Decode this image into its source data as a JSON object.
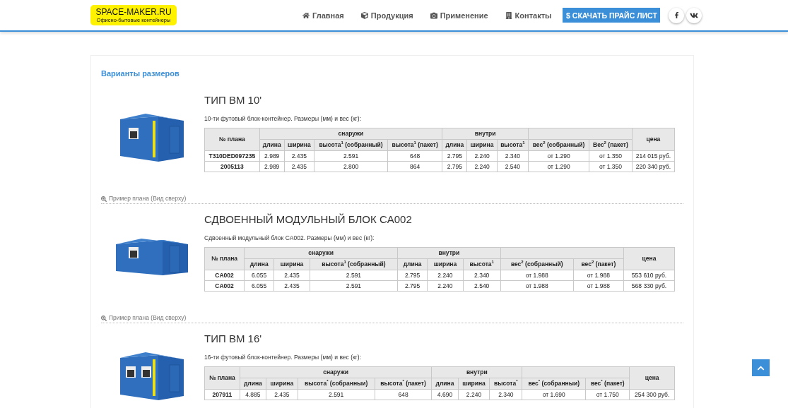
{
  "header": {
    "logo": {
      "title": "SPACE-MAKER.RU",
      "subtitle": "Офисно-бытовые контейнеры"
    },
    "nav": [
      {
        "label": "Главная",
        "kind": "home"
      },
      {
        "label": "Продукция",
        "kind": "cube"
      },
      {
        "label": "Применение",
        "kind": "camera"
      },
      {
        "label": "Контакты",
        "kind": "building"
      }
    ],
    "price_button": "$ СКАЧАТЬ ПРАЙС ЛИСТ",
    "social": [
      {
        "kind": "facebook"
      },
      {
        "kind": "vk"
      }
    ]
  },
  "heading": "Варианты размеров",
  "sections": [
    {
      "title": "ТИП ВМ 10'",
      "description": "10-ти футовый блок-контейнер. Размеры (мм) и вес (кг):",
      "image": {
        "kind": "picture"
      },
      "plan_header": "№ плана",
      "outside_header": "снаружи",
      "inside_header": "внутри",
      "price_header": "цена",
      "outside_columns": [
        "длина",
        "ширина",
        "высота$^{1}$ (собранный)",
        "высота$^{1}$ (пакет)"
      ],
      "inside_columns": [
        "длина",
        "ширина",
        "высота$^{1}$"
      ],
      "weight_columns": [
        "вес$^{2}$ (собранный)",
        "Вес$^{2}$ (пакет)"
      ],
      "rows": [
        [
          "T310DED097235",
          "2.989",
          "2.435",
          "2.591",
          "648",
          "2.795",
          "2.240",
          "2.340",
          "от 1.290",
          "от 1.350",
          "214 015 руб."
        ],
        [
          "2005113",
          "2.989",
          "2.435",
          "2.800",
          "864",
          "2.795",
          "2.240",
          "2.540",
          "от 1.290",
          "от 1.350",
          "220 340 руб."
        ]
      ],
      "plan_link": "Пример плана (Вид сверху)"
    },
    {
      "title": "СДВОЕННЫЙ МОДУЛЬНЫЙ БЛОК CA002",
      "description": "Сдвоенный модульный блок CA002. Размеры (мм) и вес (кг):",
      "image": {
        "kind": "picture"
      },
      "plan_header": "№ плана",
      "outside_header": "снаружи",
      "inside_header": "внутри",
      "price_header": "цена",
      "outside_columns": [
        "длина",
        "ширина",
        "высота$^{1}$ (собранный)"
      ],
      "inside_columns": [
        "длина",
        "ширина",
        "высота$^{1}$"
      ],
      "weight_columns": [
        "вес$^{2}$ (собранный)",
        "вес$^{2}$ (пакет)"
      ],
      "rows": [
        [
          "CA002",
          "6.055",
          "2.435",
          "2.591",
          "2.795",
          "2.240",
          "2.340",
          "от 1.988",
          "от 1.988",
          "553 610 руб."
        ],
        [
          "CA002",
          "6.055",
          "2.435",
          "2.591",
          "2.795",
          "2.240",
          "2.540",
          "от 1.988",
          "от 1.988",
          "568 330 руб."
        ]
      ],
      "plan_link": "Пример плана (Вид сверху)"
    },
    {
      "title": "ТИП ВМ 16'",
      "description": "16-ти футовый блок-контейнер. Размеры (мм) и вес (кг):",
      "image": {
        "kind": "picture"
      },
      "plan_header": "№ плана",
      "outside_header": "снаружи",
      "inside_header": "внутри",
      "price_header": "цена",
      "outside_columns": [
        "длина",
        "ширина",
        "высота$^{*}$ (собранныи)",
        "высота$^{*}$ (пакет)"
      ],
      "inside_columns": [
        "длина",
        "ширина",
        "высота$^{*}$"
      ],
      "weight_columns": [
        "вес$^{*}$ (собранныи)",
        "вес$^{*}$ (пакет)"
      ],
      "rows": [
        [
          "207911",
          "4.885",
          "2.435",
          "2.591",
          "648",
          "4.690",
          "2.240",
          "2.340",
          "от 1.690",
          "от 1.750",
          "254 300 руб."
        ]
      ]
    }
  ]
}
